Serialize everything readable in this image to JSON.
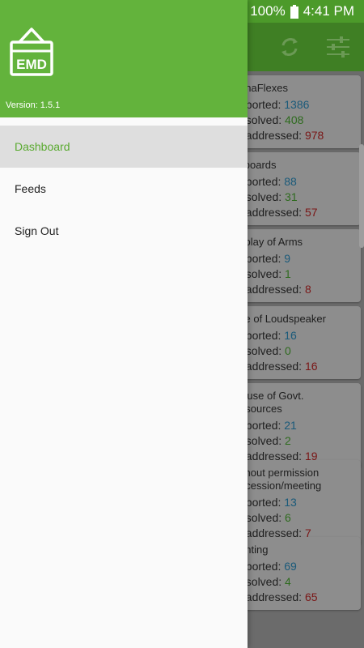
{
  "status_bar": {
    "battery": "100%",
    "time": "4:41 PM"
  },
  "toolbar": {
    "refresh_icon": "refresh-icon",
    "filter_icon": "sliders-icon"
  },
  "drawer": {
    "logo_text": "EMD",
    "version": "Version: 1.5.1",
    "menu": [
      {
        "label": "Dashboard",
        "active": true
      },
      {
        "label": "Feeds",
        "active": false
      },
      {
        "label": "Sign Out",
        "active": false
      }
    ]
  },
  "cards": [
    {
      "title": "anaFlexes",
      "reported_label": "eported:",
      "reported": "1386",
      "resolved_label": "esolved:",
      "resolved": "408",
      "unaddressed_label": "naddressed:",
      "unaddressed": "978"
    },
    {
      "title": "llboards",
      "reported_label": "eported:",
      "reported": "88",
      "resolved_label": "esolved:",
      "resolved": "31",
      "unaddressed_label": "naddressed:",
      "unaddressed": "57"
    },
    {
      "title": "splay of Arms",
      "reported_label": "eported:",
      "reported": "9",
      "resolved_label": "esolved:",
      "resolved": "1",
      "unaddressed_label": "naddressed:",
      "unaddressed": "8"
    },
    {
      "title": "se of Loudspeaker",
      "reported_label": "eported:",
      "reported": "16",
      "resolved_label": "esolved:",
      "resolved": "0",
      "unaddressed_label": "naddressed:",
      "unaddressed": "16"
    },
    {
      "title": "isuse of Govt.",
      "title2": "esources",
      "reported_label": "eported:",
      "reported": "21",
      "resolved_label": "esolved:",
      "resolved": "2",
      "unaddressed_label": "naddressed:",
      "unaddressed": "19"
    },
    {
      "title": "ithout permission",
      "title2": "ocession/meeting",
      "reported_label": "eported:",
      "reported": "13",
      "resolved_label": "esolved:",
      "resolved": "6",
      "unaddressed_label": "naddressed:",
      "unaddressed": "7"
    },
    {
      "title": "ghting",
      "reported_label": "eported:",
      "reported": "69",
      "resolved_label": "esolved:",
      "resolved": "4",
      "unaddressed_label": "naddressed:",
      "unaddressed": "65"
    }
  ],
  "colors": {
    "drawer_header": "#63b33c",
    "active_item_text": "#5aaa30",
    "reported": "#2a8ac0",
    "resolved": "#4aa82f",
    "unaddressed": "#c22a2a"
  }
}
